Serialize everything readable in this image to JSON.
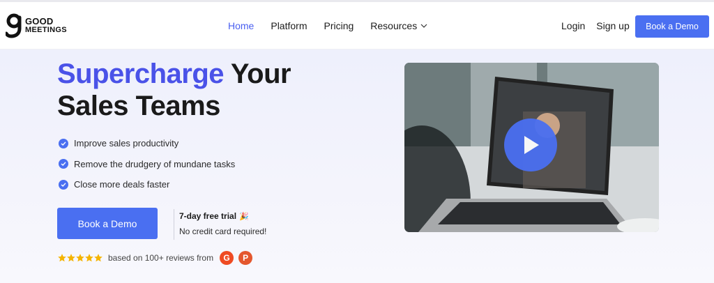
{
  "header": {
    "logo": {
      "line1": "GOOD",
      "line2": "MEETINGS"
    },
    "nav": [
      {
        "label": "Home",
        "active": true
      },
      {
        "label": "Platform"
      },
      {
        "label": "Pricing"
      },
      {
        "label": "Resources"
      }
    ],
    "login": "Login",
    "signup": "Sign up",
    "book_demo": "Book a Demo"
  },
  "hero": {
    "headline_accent": "Supercharge",
    "headline_rest_1": "Your",
    "headline_rest_2": "Sales Teams",
    "bullets": [
      "Improve sales productivity",
      "Remove the drudgery of mundane tasks",
      "Close more deals faster"
    ],
    "cta": "Book a Demo",
    "trial_title": "7-day free trial",
    "trial_emoji": "🎉",
    "trial_note": "No credit card required!",
    "rating": {
      "stars": 5,
      "text": "based on 100+ reviews from",
      "sources": [
        "G2",
        "Product Hunt"
      ]
    }
  },
  "colors": {
    "accent": "#4a6ff1",
    "headline_accent": "#4a52e8",
    "star": "#f5b400"
  }
}
